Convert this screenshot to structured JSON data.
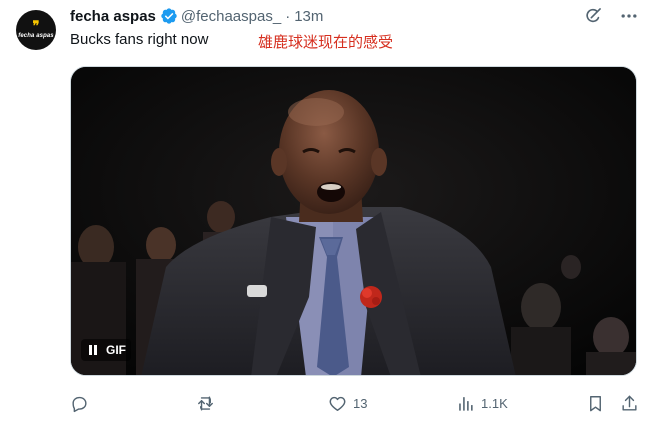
{
  "tweet": {
    "author_name": "fecha aspas",
    "handle": "@fechaaspas_",
    "separator": "·",
    "time": "13m",
    "text": "Bucks fans right now",
    "translation_overlay": "雄鹿球迷现在的感受",
    "avatar": {
      "quote_glyph": "❞",
      "brand_text": "fecha aspas"
    }
  },
  "media": {
    "type": "gif",
    "gif_label": "GIF",
    "controls": {
      "pause_icon": "pause-icon"
    }
  },
  "actions": {
    "reply": {
      "icon": "reply-icon",
      "count": ""
    },
    "repost": {
      "icon": "repost-icon",
      "count": ""
    },
    "like": {
      "icon": "heart-icon",
      "count": "13"
    },
    "views": {
      "icon": "views-chart-icon",
      "count": "1.1K"
    },
    "bookmark": {
      "icon": "bookmark-icon"
    },
    "share": {
      "icon": "share-icon"
    }
  },
  "colors": {
    "text_primary": "#0f1419",
    "text_secondary": "#536471",
    "verified_blue": "#1d9bf0",
    "translation_red": "#d62f1f"
  }
}
